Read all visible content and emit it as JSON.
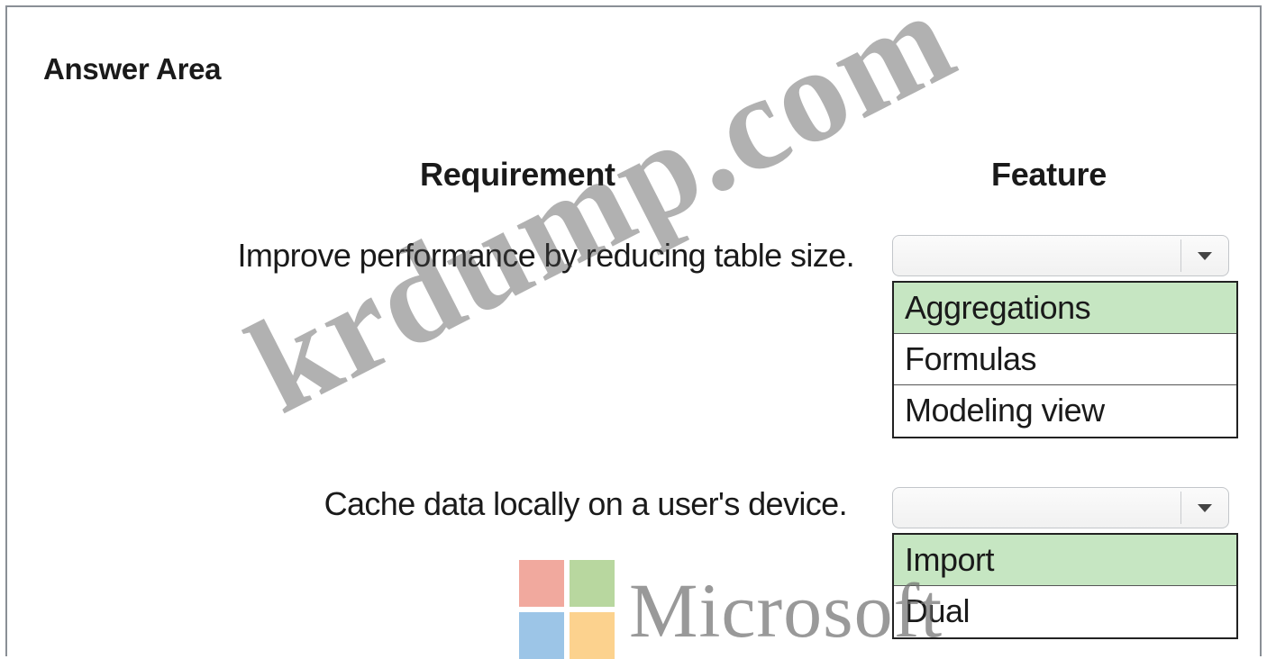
{
  "answer_area": {
    "title": "Answer Area",
    "headers": {
      "requirement": "Requirement",
      "feature": "Feature"
    },
    "rows": [
      {
        "requirement": "Improve performance by reducing table size.",
        "dropdown_value": "",
        "options": [
          {
            "label": "Aggregations",
            "selected": true
          },
          {
            "label": "Formulas",
            "selected": false
          },
          {
            "label": "Modeling view",
            "selected": false
          }
        ]
      },
      {
        "requirement": "Cache data locally on a user's device.",
        "dropdown_value": "",
        "options": [
          {
            "label": "Import",
            "selected": true
          },
          {
            "label": "Dual",
            "selected": false
          }
        ]
      }
    ]
  },
  "watermark": {
    "text": "krdump.com",
    "logo_text": "Microsoft"
  },
  "colors": {
    "selected_option": "#c6e6c2",
    "border": "#8a8f96"
  }
}
